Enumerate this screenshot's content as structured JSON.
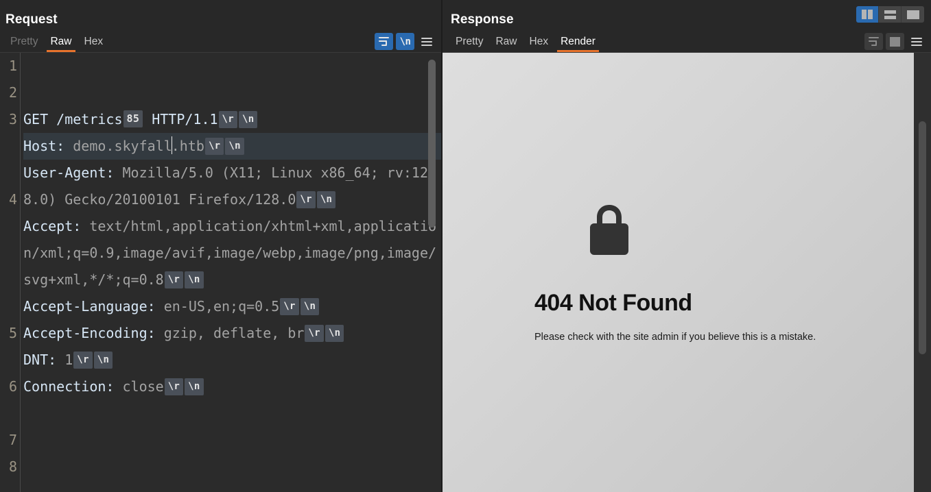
{
  "window": {
    "layout_buttons": [
      {
        "name": "side-by-side-layout",
        "label": "Side by side layout",
        "active": true
      },
      {
        "name": "stacked-layout",
        "label": "Stacked layout",
        "active": false
      },
      {
        "name": "single-pane-layout",
        "label": "Single pane layout",
        "active": false
      }
    ]
  },
  "request": {
    "title": "Request",
    "tabs": [
      {
        "label": "Pretty",
        "active": false,
        "dim": true
      },
      {
        "label": "Raw",
        "active": true,
        "dim": false
      },
      {
        "label": "Hex",
        "active": false,
        "dim": false
      }
    ],
    "tools": [
      {
        "name": "word-wrap-icon",
        "label": "Word wrap",
        "state": "on"
      },
      {
        "name": "show-newlines-icon",
        "label": "\\n",
        "state": "on"
      },
      {
        "name": "menu-icon",
        "label": "Menu",
        "state": "plain"
      }
    ],
    "lines": [
      {
        "number": "1",
        "method": "GET ",
        "path": "/metrics",
        "badge": "85",
        "proto": " HTTP/1.1",
        "cr": "\\r",
        "lf": "\\n"
      },
      {
        "number": "2",
        "name": "Host:",
        "value": " demo.skyfall",
        "value2": ".htb",
        "cr": "\\r",
        "lf": "\\n",
        "highlighted": true
      },
      {
        "number": "3",
        "name": "User-Agent:",
        "value": " Mozilla/5.0 (X11; Linux x86_64; rv:128.0) Gecko/20100101 Firefox/128.0",
        "cr": "\\r",
        "lf": "\\n"
      },
      {
        "number": "4",
        "name": "Accept:",
        "value": " text/html,application/xhtml+xml,application/xml;q=0.9,image/avif,image/webp,image/png,image/svg+xml,*/*;q=0.8",
        "cr": "\\r",
        "lf": "\\n"
      },
      {
        "number": "5",
        "name": "Accept-Language:",
        "value": " en-US,en;q=0.5",
        "cr": "\\r",
        "lf": "\\n"
      },
      {
        "number": "6",
        "name": "Accept-Encoding:",
        "value": " gzip, deflate, br",
        "cr": "\\r",
        "lf": "\\n"
      },
      {
        "number": "7",
        "name": "DNT:",
        "value": " 1",
        "cr": "\\r",
        "lf": "\\n"
      },
      {
        "number": "8",
        "name": "Connection:",
        "value": " close",
        "cr": "\\r",
        "lf": "\\n"
      }
    ]
  },
  "response": {
    "title": "Response",
    "tabs": [
      {
        "label": "Pretty",
        "active": false,
        "dim": false
      },
      {
        "label": "Raw",
        "active": false,
        "dim": false
      },
      {
        "label": "Hex",
        "active": false,
        "dim": false
      },
      {
        "label": "Render",
        "active": true,
        "dim": false
      }
    ],
    "tools": [
      {
        "name": "word-wrap-icon",
        "label": "Word wrap",
        "state": "off"
      },
      {
        "name": "show-newlines-icon",
        "label": "\\n",
        "state": "off"
      },
      {
        "name": "menu-icon",
        "label": "Menu",
        "state": "plain"
      }
    ],
    "rendered": {
      "icon": "lock-icon",
      "title": "404 Not Found",
      "subtitle": "Please check with the site admin if you believe this is a mistake."
    }
  },
  "colors": {
    "accent_orange": "#e8732c",
    "accent_blue": "#2a6ab0",
    "editor_bg": "#2b2b2b",
    "chrome_bg": "#282828",
    "header_name": "#d6e6f5",
    "header_value": "#a3a3a3"
  }
}
